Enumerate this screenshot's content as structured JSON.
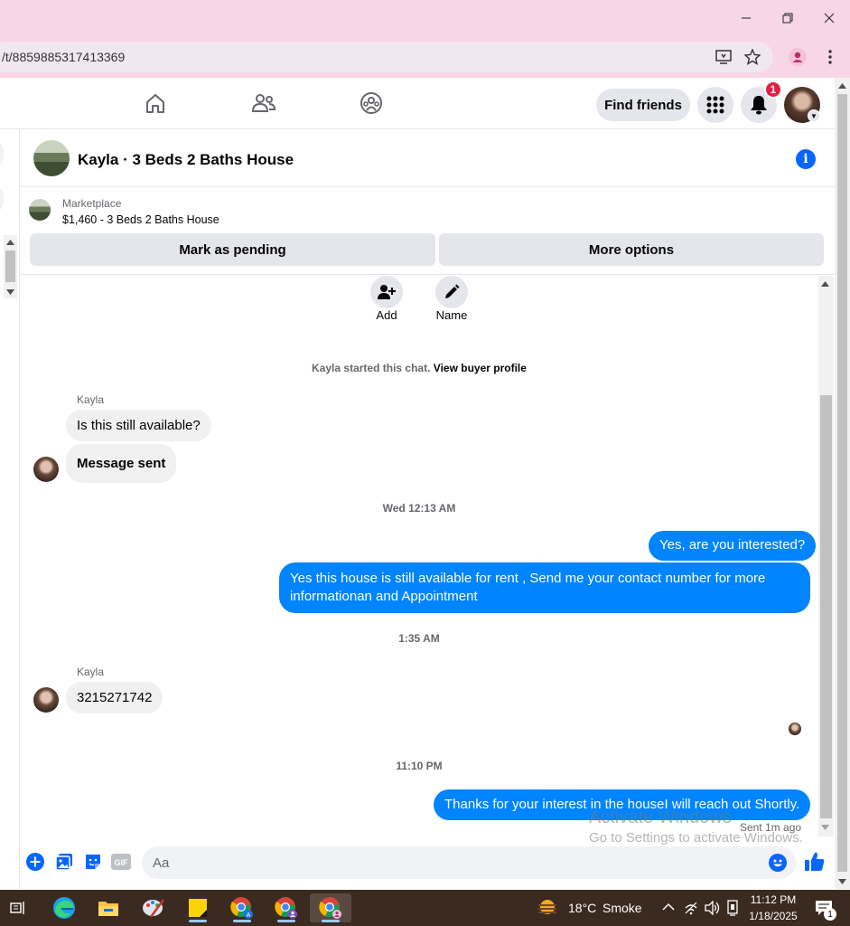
{
  "browser": {
    "url": "/t/8859885317413369",
    "window_controls": [
      "minimize",
      "restore",
      "close"
    ]
  },
  "fb_nav": {
    "find_friends_label": "Find friends",
    "notification_count": "1"
  },
  "chat": {
    "title": "Kayla · 3 Beds 2 Baths House",
    "marketplace_label": "Marketplace",
    "listing_title": "$1,460 - 3 Beds 2 Baths House",
    "mark_pending_label": "Mark as pending",
    "more_options_label": "More options",
    "actions": [
      {
        "label": "Add"
      },
      {
        "label": "Name"
      }
    ],
    "started_text": "Kayla started this chat.",
    "view_profile_label": "View buyer profile",
    "messages": [
      {
        "sender": "Kayla",
        "text": "Is this still available?"
      },
      {
        "text": "Message sent"
      },
      {
        "timestamp": "Wed 12:13 AM"
      },
      {
        "text": "Yes, are you interested?"
      },
      {
        "text": "Yes this house is still available for rent , Send me your contact number for more informationan and Appointment"
      },
      {
        "timestamp": "1:35 AM"
      },
      {
        "sender": "Kayla",
        "text": "3215271742"
      },
      {
        "timestamp": "11:10 PM"
      },
      {
        "text": "Thanks for your interest in the houseI will reach out Shortly."
      }
    ],
    "sent_status": "Sent 1m ago",
    "input_placeholder": "Aa",
    "gif_label": "GIF"
  },
  "watermark": {
    "line1": "Activate Windows",
    "line2": "Go to Settings to activate Windows."
  },
  "taskbar": {
    "weather_temp": "18°C",
    "weather_text": "Smoke",
    "time": "11:12 PM",
    "date": "1/18/2025",
    "notification_count": "1"
  },
  "colors": {
    "accent": "#0866ff",
    "outgoing_bubble": "#0084ff",
    "incoming_bubble": "#f0f0f0",
    "browser_chrome": "#f7d6e8",
    "taskbar": "#3b2a20"
  }
}
